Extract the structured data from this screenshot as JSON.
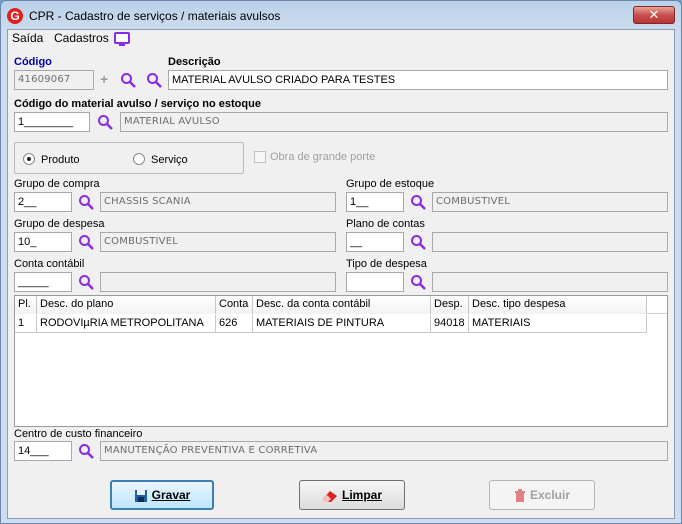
{
  "window": {
    "title": "CPR - Cadastro de serviços / materiais avulsos",
    "app_icon": "G",
    "close_glyph": "✕"
  },
  "menu": {
    "items": [
      "Saída",
      "Cadastros"
    ]
  },
  "codigo": {
    "label": "Código",
    "value": "41609067"
  },
  "descricao": {
    "label": "Descrição",
    "value": "MATERIAL AVULSO CRIADO PARA TESTES"
  },
  "estoque": {
    "label": "Código do material avulso / serviço no estoque",
    "code": "1________",
    "desc": "MATERIAL AVULSO"
  },
  "tipo": {
    "options": [
      "Produto",
      "Serviço"
    ],
    "selected": "Produto",
    "obra_label": "Obra de grande porte"
  },
  "grupo_compra": {
    "label": "Grupo de compra",
    "code": "2__",
    "desc": "CHASSIS SCANIA"
  },
  "grupo_estoque": {
    "label": "Grupo de estoque",
    "code": "1__",
    "desc": "COMBUSTIVEL"
  },
  "grupo_despesa": {
    "label": "Grupo de despesa",
    "code": "10_",
    "desc": "COMBUSTIVEL"
  },
  "plano_contas": {
    "label": "Plano de contas",
    "code": "__",
    "desc": ""
  },
  "conta_contabil": {
    "label": "Conta contábil",
    "code": "_____",
    "desc": ""
  },
  "tipo_despesa": {
    "label": "Tipo de despesa",
    "code": "",
    "desc": ""
  },
  "grid": {
    "columns": [
      "Pl.",
      "Desc. do plano",
      "Conta",
      "Desc. da conta contábil",
      "Desp.",
      "Desc. tipo despesa"
    ],
    "rows": [
      [
        "1",
        "RODOVIµRIA METROPOLITANA",
        "626",
        "MATERIAIS DE PINTURA",
        "94018",
        "MATERIAIS"
      ]
    ]
  },
  "centro_custo": {
    "label": "Centro de custo financeiro",
    "code": "14___",
    "desc": "MANUTENÇÃO PREVENTIVA E CORRETIVA"
  },
  "buttons": {
    "gravar": "Gravar",
    "limpar": "Limpar",
    "excluir": "Excluir"
  },
  "colors": {
    "accent_label": "#0000a8",
    "search_icon": "#8a2be2",
    "close": "#c75050"
  }
}
